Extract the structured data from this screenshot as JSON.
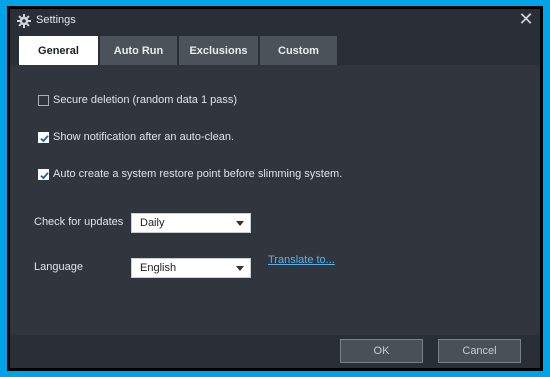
{
  "window": {
    "title": "Settings"
  },
  "tabs": [
    {
      "label": "General",
      "active": true
    },
    {
      "label": "Auto Run",
      "active": false
    },
    {
      "label": "Exclusions",
      "active": false
    },
    {
      "label": "Custom",
      "active": false
    }
  ],
  "options": [
    {
      "label": "Secure deletion (random data 1 pass)",
      "checked": false
    },
    {
      "label": "Show notification after an auto-clean.",
      "checked": true
    },
    {
      "label": "Auto create a system restore point before slimming system.",
      "checked": true
    }
  ],
  "updates": {
    "label": "Check for updates",
    "value": "Daily"
  },
  "language": {
    "label": "Language",
    "value": "English",
    "translate_link": "Translate to..."
  },
  "footer": {
    "ok_label": "OK",
    "cancel_label": "Cancel"
  },
  "colors": {
    "background": "#00a3e8",
    "window": "#2a2f37",
    "content": "#31363e",
    "active_tab": "#ffffff",
    "link": "#57b2ee"
  }
}
